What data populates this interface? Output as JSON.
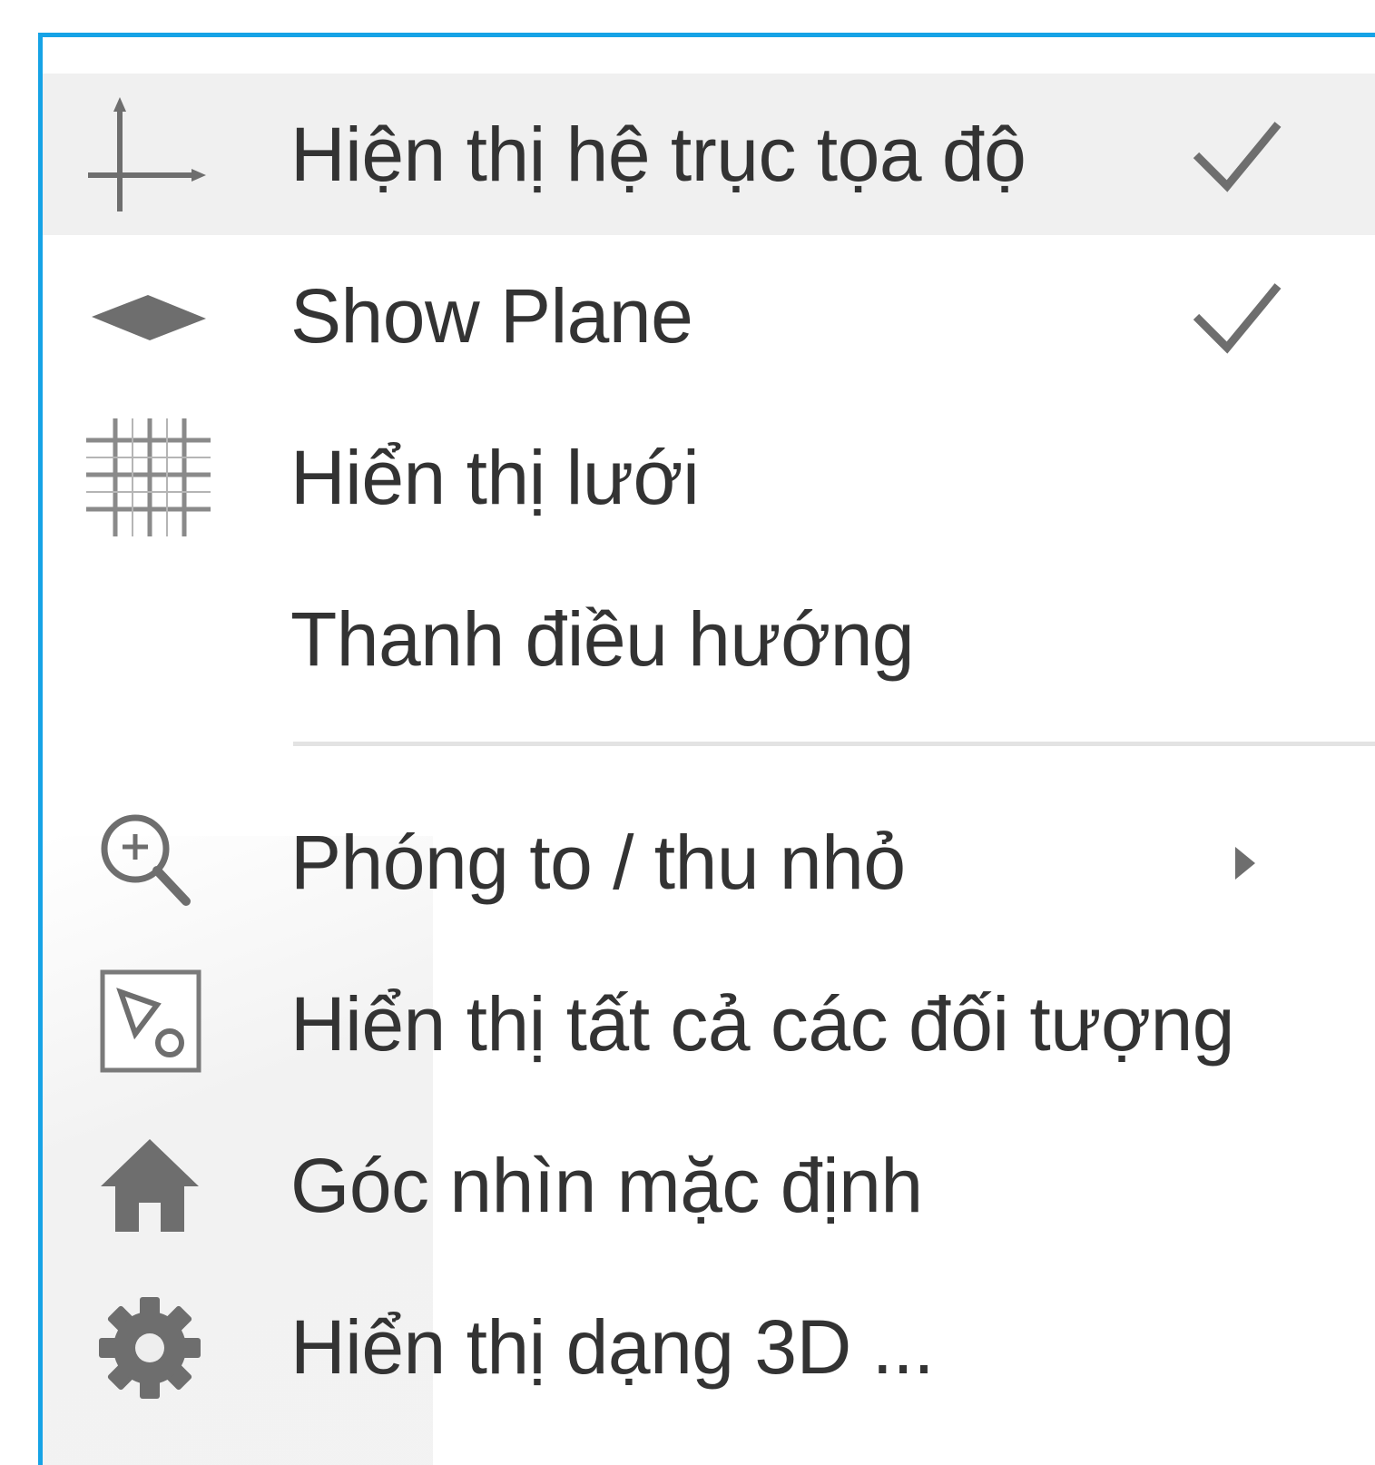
{
  "menu": {
    "items": [
      {
        "label": "Hiện thị hệ trục tọa độ",
        "icon": "axes-icon",
        "checked": true,
        "highlighted": true
      },
      {
        "label": "Show Plane",
        "icon": "plane-icon",
        "checked": true
      },
      {
        "label": "Hiển thị lưới",
        "icon": "grid-icon",
        "checked": false
      },
      {
        "label": "Thanh điều hướng",
        "icon": "",
        "checked": false
      },
      {
        "label": "Phóng to / thu nhỏ",
        "icon": "zoom-in-icon",
        "submenu": true
      },
      {
        "label": "Hiển thị tất cả các đối tượng",
        "icon": "show-all-objects-icon"
      },
      {
        "label": "Góc nhìn mặc định",
        "icon": "home-icon"
      },
      {
        "label": "Hiển thị dạng 3D ...",
        "icon": "gear-icon"
      }
    ]
  },
  "colors": {
    "border": "#16a3e6",
    "highlight": "#f0f0f0",
    "icon": "#6e6e6e",
    "text": "#333333"
  }
}
